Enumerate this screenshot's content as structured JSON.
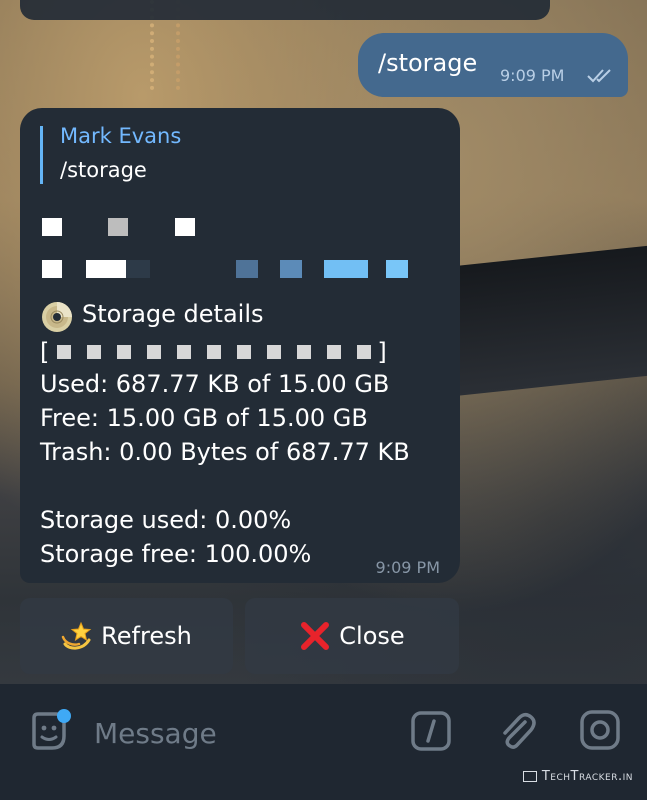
{
  "outgoing": {
    "text": "/storage",
    "time": "9:09 PM"
  },
  "incoming": {
    "reply_name": "Mark Evans",
    "reply_text": "/storage",
    "title": "Storage details",
    "bar_open": "[",
    "bar_close": "]",
    "bar_squares": 11,
    "lines": [
      "Used: 687.77 KB of 15.00 GB",
      "Free: 15.00 GB of 15.00 GB",
      "Trash: 0.00 Bytes of 687.77 KB",
      "",
      "Storage used: 0.00%",
      "Storage free: 100.00%"
    ],
    "time": "9:09 PM"
  },
  "buttons": {
    "refresh": "Refresh",
    "close": "Close"
  },
  "input": {
    "placeholder": "Message"
  },
  "watermark": "TechTracker.in",
  "colors": {
    "outgoing_bubble": "#44698e",
    "incoming_bubble": "#232c36",
    "reply_accent": "#73b9ff",
    "input_bar": "#1f2731"
  },
  "icons": {
    "disc": "disc-icon",
    "refresh": "dizzy-star-icon",
    "close": "red-x-icon",
    "sticker": "sticker-icon",
    "commands": "slash-command-icon",
    "attach": "paperclip-icon",
    "camera": "camera-icon",
    "read_status": "double-check-icon"
  }
}
